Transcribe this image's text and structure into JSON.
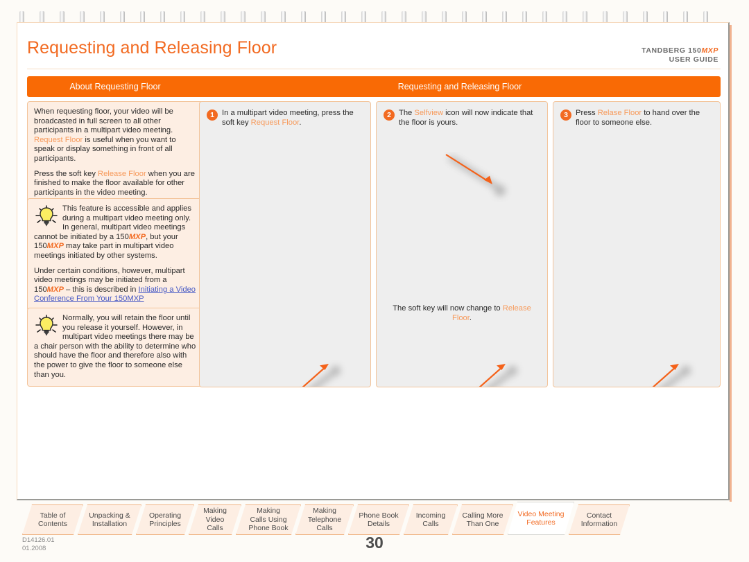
{
  "header": {
    "title": "Requesting and Releasing Floor",
    "brand_line1_prefix": "TANDBERG 150",
    "brand_line1_suffix": "MXP",
    "brand_line2": "USER GUIDE"
  },
  "bars": {
    "left": "About Requesting Floor",
    "right": "Requesting and Releasing Floor"
  },
  "left_column": {
    "intro": {
      "p1_a": "When requesting floor, your video will be broadcasted in full screen to all other participants in a multipart video meeting. ",
      "p1_link": "Request Floor",
      "p1_b": " is useful when you want to speak or display something in front of all participants.",
      "p2_a": "Press the soft key ",
      "p2_link": "Release Floor",
      "p2_b": " when you are finished to make the floor available for other participants in the video meeting."
    },
    "tip1": {
      "icon": "lightbulb-icon",
      "p1_a": "This feature is accessible and applies during a multipart video meeting only. In general, multipart video meetings cannot be initiated by a 150",
      "p1_mxp1": "MXP",
      "p1_b": ", but your 150",
      "p1_mxp2": "MXP",
      "p1_c": " may take part in multipart video meetings initiated by other systems.",
      "p2_a": "Under certain conditions, however, multipart video meetings may be initiated from a 150",
      "p2_mxp": "MXP",
      "p2_b": " – this is described in ",
      "p2_link": "Initiating a Video Conference From Your 150MXP"
    },
    "tip2": {
      "icon": "lightbulb-icon",
      "text": "Normally, you will retain the floor until you release it yourself. However, in multipart video meetings there may be a chair person with the ability to determine who should have the floor and therefore also with the power to give the floor to someone else than you."
    }
  },
  "steps": [
    {
      "number": "1",
      "text_a": "In a multipart video meeting, press the soft key ",
      "text_link": "Request Floor",
      "text_b": "."
    },
    {
      "number": "2",
      "text_a": "The ",
      "text_link": "Selfview",
      "text_b": " icon will now indicate that the floor is yours.",
      "caption_a": "The soft key will now change to ",
      "caption_link": "Release Floor",
      "caption_b": "."
    },
    {
      "number": "3",
      "text_a": "Press ",
      "text_link": "Relase Floor",
      "text_b": " to hand over the floor to someone else."
    }
  ],
  "tabs": [
    {
      "label": "Table of\nContents",
      "active": false
    },
    {
      "label": "Unpacking &\nInstallation",
      "active": false
    },
    {
      "label": "Operating\nPrinciples",
      "active": false
    },
    {
      "label": "Making\nVideo\nCalls",
      "active": false
    },
    {
      "label": "Making\nCalls Using\nPhone Book",
      "active": false
    },
    {
      "label": "Making\nTelephone\nCalls",
      "active": false
    },
    {
      "label": "Phone Book\nDetails",
      "active": false
    },
    {
      "label": "Incoming\nCalls",
      "active": false
    },
    {
      "label": "Calling More\nThan One",
      "active": false
    },
    {
      "label": "Video Meeting\nFeatures",
      "active": true
    },
    {
      "label": "Contact\nInformation",
      "active": false
    }
  ],
  "footer": {
    "doc_id": "D14126.01",
    "doc_date": "01.2008",
    "page_number": "30"
  },
  "colors": {
    "accent_orange": "#f26a21",
    "bar_orange": "#f96a05",
    "soft_key_orange": "#f79a5b",
    "box_bg": "#fdeee3",
    "panel_bg": "#eeeeee",
    "link_blue": "#4356c4"
  }
}
